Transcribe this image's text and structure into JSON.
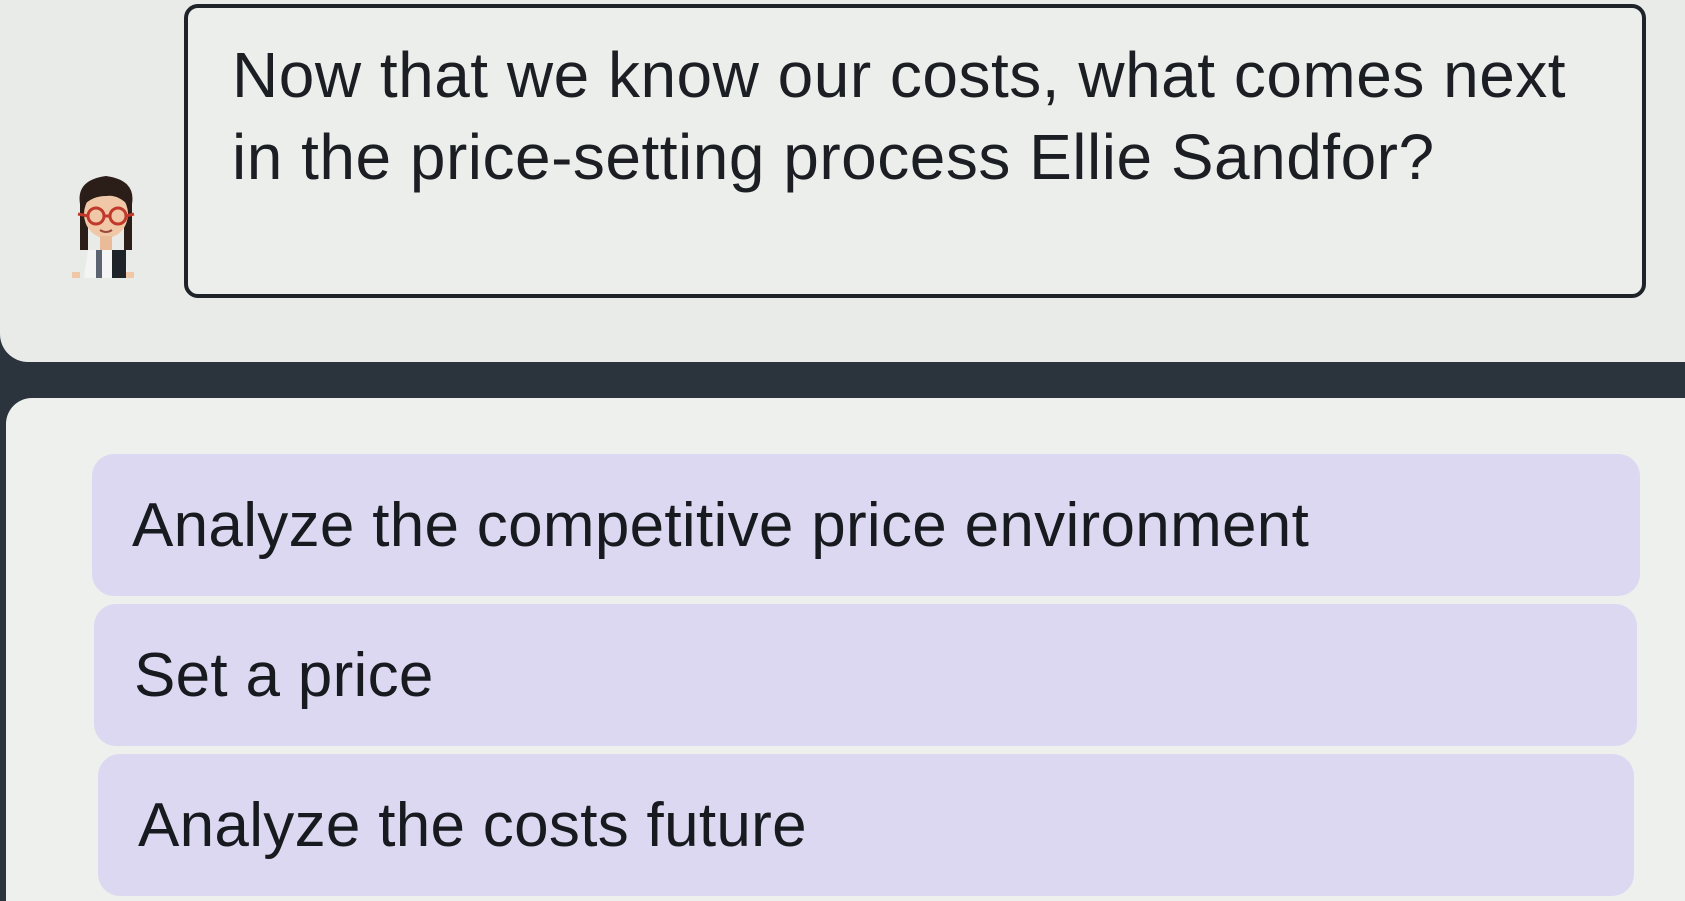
{
  "dialogue": {
    "question": "Now that we know our costs, what comes next in the price-setting process Ellie Sandfor?",
    "avatar_icon": "character-avatar-icon"
  },
  "answers": [
    {
      "label": "Analyze the competitive price environment"
    },
    {
      "label": "Set a price"
    },
    {
      "label": "Analyze the costs future"
    }
  ],
  "colors": {
    "background": "#2b333d",
    "panel": "#e9ebe8",
    "speech_border": "#1e2329",
    "answer_fill": "#dcd8f1"
  }
}
